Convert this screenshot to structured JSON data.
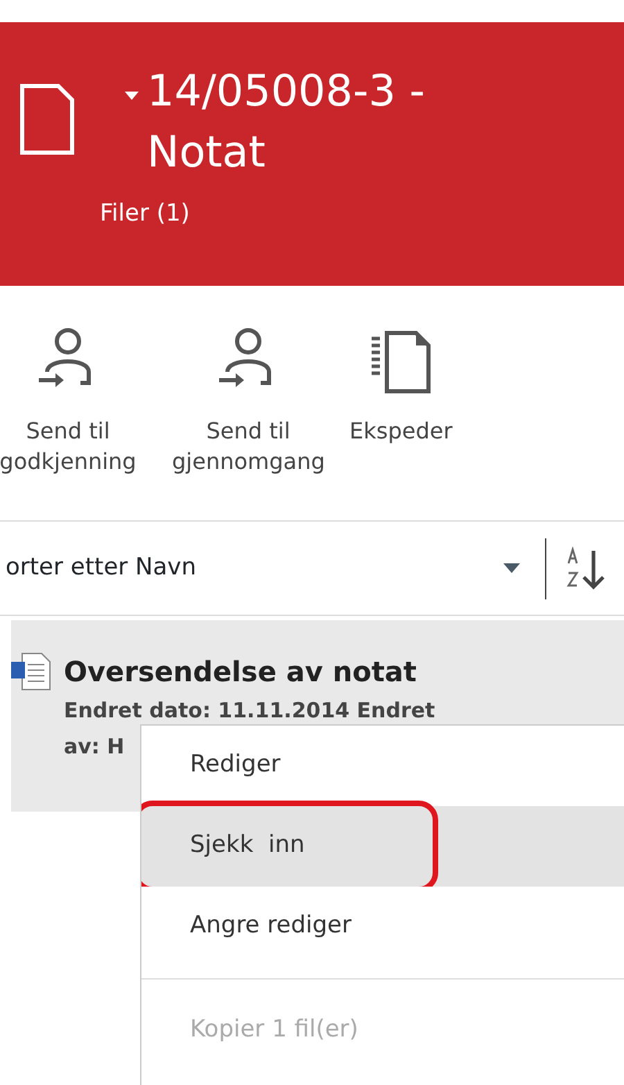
{
  "header": {
    "title": "14/05008-3 - Notat",
    "subtitle": "Filer (1)"
  },
  "toolbar": [
    {
      "kind": "person",
      "label": "Send til godkjenning"
    },
    {
      "kind": "person",
      "label": "Send til gjennomgang"
    },
    {
      "kind": "document",
      "label": "Ekspeder"
    }
  ],
  "sort": {
    "label": "orter etter Navn"
  },
  "files": [
    {
      "name": "Oversendelse av notat",
      "details": "Endret dato: 11.11.2014 Endret av: H",
      "selected": true
    }
  ],
  "context_menu": [
    {
      "label": "Rediger",
      "selected": false,
      "disabled": false,
      "circled": false
    },
    {
      "label": "Sjekk  inn",
      "selected": true,
      "disabled": false,
      "circled": true
    },
    {
      "label": "Angre rediger",
      "selected": false,
      "disabled": false,
      "circled": false
    },
    {
      "kind": "separator"
    },
    {
      "label": "Kopier 1 fil(er)",
      "selected": false,
      "disabled": true,
      "circled": false
    }
  ]
}
